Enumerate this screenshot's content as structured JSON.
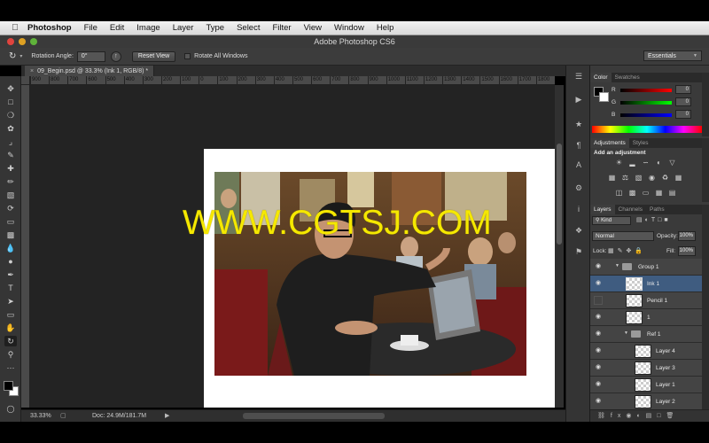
{
  "menubar": {
    "items": [
      "Photoshop",
      "File",
      "Edit",
      "Image",
      "Layer",
      "Type",
      "Select",
      "Filter",
      "View",
      "Window",
      "Help"
    ]
  },
  "titlebar": {
    "title": "Adobe Photoshop CS6"
  },
  "options": {
    "rotation_label": "Rotation Angle:",
    "rotation_value": "0°",
    "reset_label": "Reset View",
    "rotate_all_label": "Rotate All Windows",
    "workspace": "Essentials"
  },
  "document": {
    "tab_title": "09_Begin.psd @ 33.3% (Ink 1, RGB/8) *",
    "zoom": "33.33%",
    "doc_size": "Doc: 24.9M/181.7M"
  },
  "ruler": {
    "ticks": [
      "900",
      "800",
      "700",
      "600",
      "500",
      "400",
      "300",
      "200",
      "100",
      "0",
      "100",
      "200",
      "300",
      "400",
      "500",
      "600",
      "700",
      "800",
      "900",
      "1000",
      "1100",
      "1200",
      "1300",
      "1400",
      "1500",
      "1600",
      "1700",
      "1800"
    ]
  },
  "watermark": "WWW.CGTSJ.COM",
  "color_panel": {
    "tabs": [
      "Color",
      "Swatches"
    ],
    "r_label": "R",
    "r_value": "0",
    "g_label": "G",
    "g_value": "0",
    "b_label": "B",
    "b_value": "0"
  },
  "adjustments_panel": {
    "tabs": [
      "Adjustments",
      "Styles"
    ],
    "heading": "Add an adjustment"
  },
  "layers_panel": {
    "tabs": [
      "Layers",
      "Channels",
      "Paths"
    ],
    "filter": "Kind",
    "blend_mode": "Normal",
    "opacity_label": "Opacity:",
    "opacity_value": "100%",
    "lock_label": "Lock:",
    "fill_label": "Fill:",
    "fill_value": "100%",
    "layers": [
      {
        "name": "Group 1",
        "kind": "group"
      },
      {
        "name": "Ink 1",
        "kind": "layer"
      },
      {
        "name": "Pencil 1",
        "kind": "layer"
      },
      {
        "name": "1",
        "kind": "layer"
      },
      {
        "name": "Ref 1",
        "kind": "group"
      },
      {
        "name": "Layer 4",
        "kind": "layer"
      },
      {
        "name": "Layer 3",
        "kind": "layer"
      },
      {
        "name": "Layer 1",
        "kind": "layer"
      },
      {
        "name": "Layer 2",
        "kind": "layer"
      }
    ]
  },
  "colors": {
    "selection": "#3f5c80",
    "watermark": "#f5e800"
  }
}
